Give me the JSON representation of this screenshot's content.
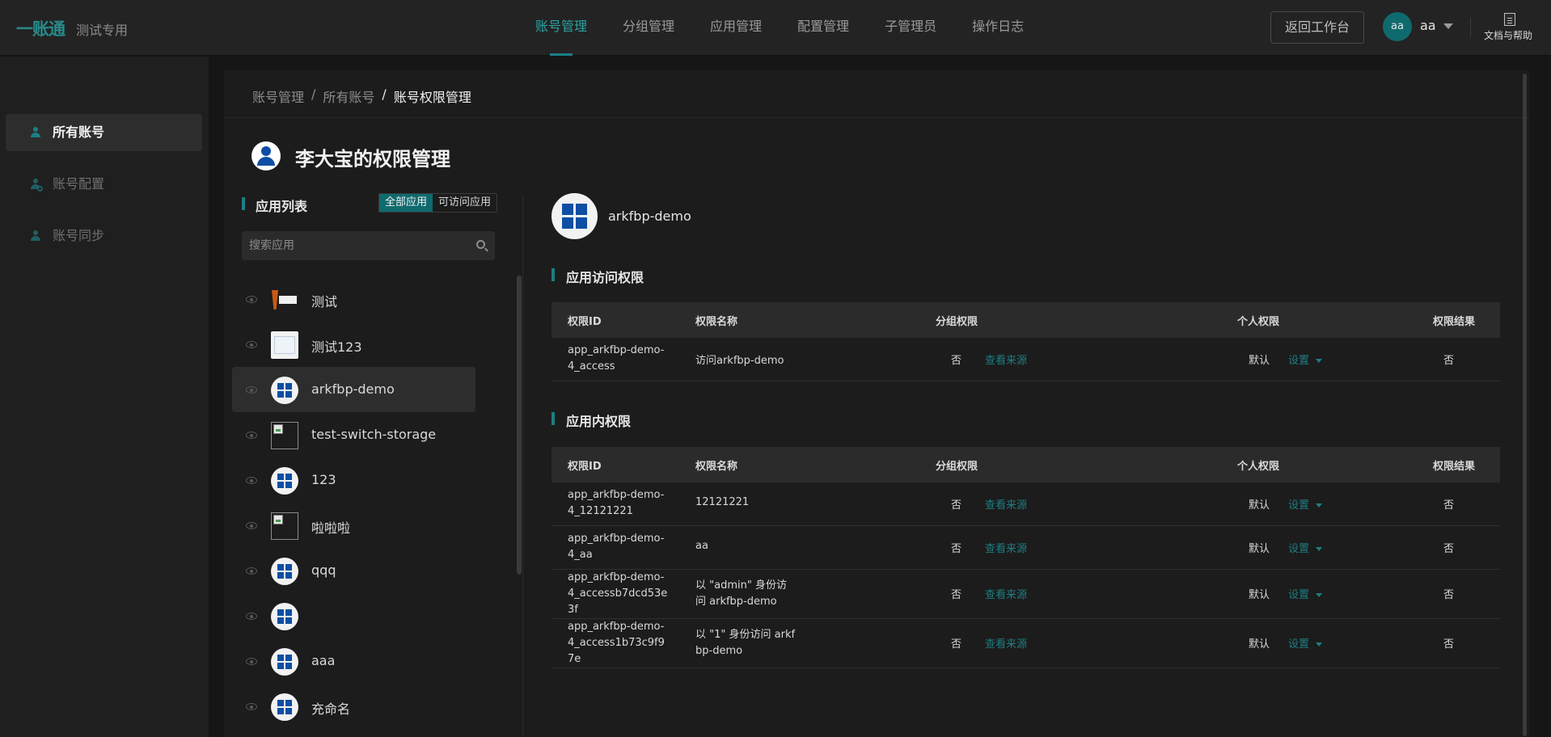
{
  "header": {
    "logo": "一账通",
    "subtitle": "测试专用",
    "nav": [
      "账号管理",
      "分组管理",
      "应用管理",
      "配置管理",
      "子管理员",
      "操作日志"
    ],
    "back_button": "返回工作台",
    "user_avatar": "aa",
    "user_name": "aa",
    "docs_label": "文档与帮助"
  },
  "sidebar": {
    "items": [
      {
        "label": "所有账号",
        "icon": "user-icon"
      },
      {
        "label": "账号配置",
        "icon": "user-settings-icon"
      },
      {
        "label": "账号同步",
        "icon": "sync-icon"
      }
    ]
  },
  "breadcrumb": {
    "items": [
      "账号管理",
      "所有账号",
      "账号权限管理"
    ],
    "sep": "/"
  },
  "page": {
    "title": "李大宝的权限管理"
  },
  "app_list": {
    "title": "应用列表",
    "filter_all": "全部应用",
    "filter_accessible": "可访问应用",
    "search_placeholder": "搜索应用",
    "apps": [
      {
        "name": "测试",
        "logo": "t-logo"
      },
      {
        "name": "测试123",
        "logo": "screenshot-logo"
      },
      {
        "name": "arkfbp-demo",
        "logo": "windows-logo"
      },
      {
        "name": "test-switch-storage",
        "logo": "broken-image"
      },
      {
        "name": "123",
        "logo": "windows-logo"
      },
      {
        "name": "啦啦啦",
        "logo": "broken-image"
      },
      {
        "name": "qqq",
        "logo": "windows-logo"
      },
      {
        "name": "",
        "logo": "windows-logo"
      },
      {
        "name": "aaa",
        "logo": "windows-logo"
      },
      {
        "name": "充命名",
        "logo": "windows-logo"
      }
    ]
  },
  "detail": {
    "app_name": "arkfbp-demo",
    "access_section": "应用访问权限",
    "inner_section": "应用内权限",
    "columns": [
      "权限ID",
      "权限名称",
      "分组权限",
      "个人权限",
      "权限结果"
    ],
    "view_source": "查看来源",
    "set_label": "设置",
    "access_rows": [
      {
        "id": "app_arkfbp-demo-4_access",
        "name": "访问arkfbp-demo",
        "group": "否",
        "personal": "默认",
        "result": "否"
      }
    ],
    "inner_rows": [
      {
        "id": "app_arkfbp-demo-4_12121221",
        "name": "12121221",
        "group": "否",
        "personal": "默认",
        "result": "否"
      },
      {
        "id": "app_arkfbp-demo-4_aa",
        "name": "aa",
        "group": "否",
        "personal": "默认",
        "result": "否"
      },
      {
        "id": "app_arkfbp-demo-4_accessb7dcd53e3f",
        "name": "以 \"admin\" 身份访问 arkfbp-demo",
        "group": "否",
        "personal": "默认",
        "result": "否"
      },
      {
        "id": "app_arkfbp-demo-4_access1b73c9f97e",
        "name": "以 \"1\" 身份访问 arkfbp-demo",
        "group": "否",
        "personal": "默认",
        "result": "否"
      }
    ]
  },
  "colors": {
    "accent": "#1a7f84",
    "nav_active": "#2aa3a3",
    "background": "#161616",
    "panel": "#1c1c1c",
    "windows_blue": "#0e4ea3"
  }
}
